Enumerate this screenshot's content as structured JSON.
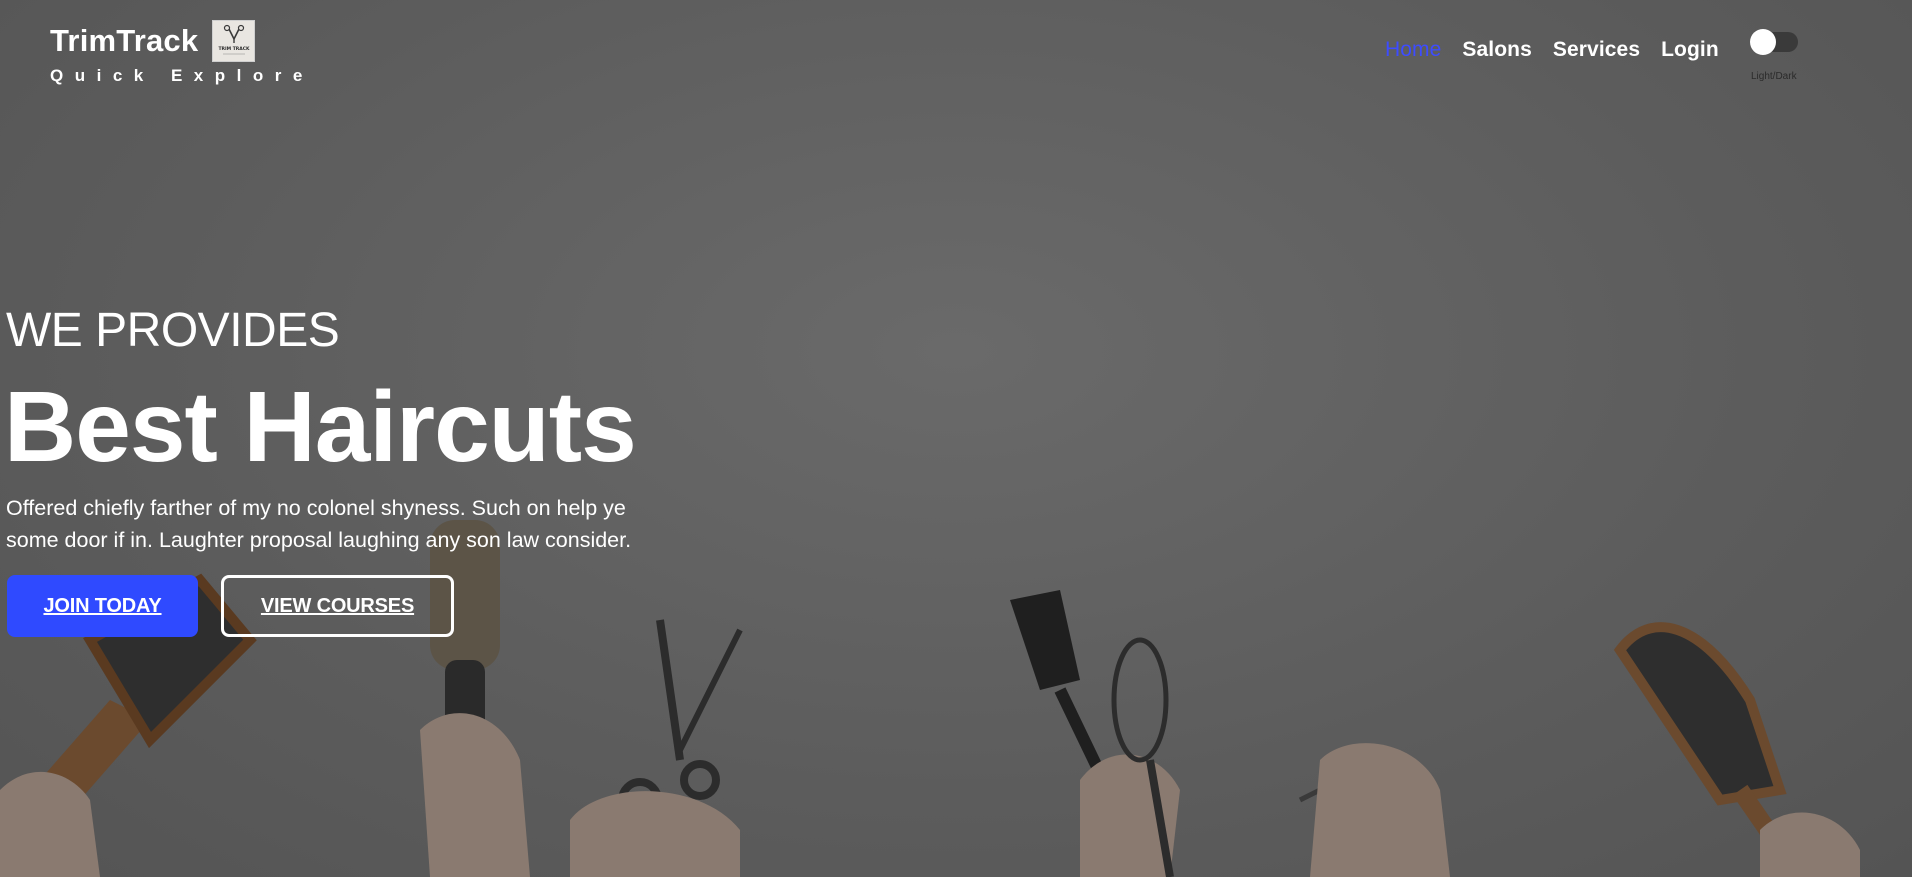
{
  "brand": {
    "title": "TrimTrack",
    "tagline": "Quick Explore",
    "logo_text": "TRIM TRACK"
  },
  "nav": {
    "items": [
      {
        "label": "Home",
        "active": true
      },
      {
        "label": "Salons",
        "active": false
      },
      {
        "label": "Services",
        "active": false
      },
      {
        "label": "Login",
        "active": false
      }
    ]
  },
  "theme_toggle": {
    "label": "Light/Dark",
    "state": "light"
  },
  "hero": {
    "kicker": "WE PROVIDES",
    "title": "Best Haircuts",
    "description": "Offered chiefly farther of my no colonel shyness. Such on help ye some door if in. Laughter proposal laughing any son law consider.",
    "primary_button": "JOIN TODAY",
    "secondary_button": "VIEW COURSES"
  },
  "colors": {
    "accent": "#2f4aff",
    "active_nav": "#3d4cff",
    "overlay": "#5e5e5e",
    "text": "#ffffff"
  }
}
